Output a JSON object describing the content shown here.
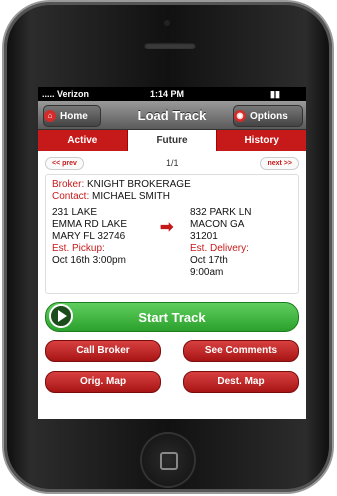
{
  "status": {
    "carrier": "..... Verizon",
    "time": "1:14 PM"
  },
  "navbar": {
    "title": "Load Track",
    "home_label": "Home",
    "options_label": "Options"
  },
  "tabs": [
    {
      "label": "Active"
    },
    {
      "label": "Future"
    },
    {
      "label": "History"
    }
  ],
  "pager": {
    "prev": "<< prev",
    "page": "1/1",
    "next": "next >>"
  },
  "load": {
    "broker_label": "Broker:",
    "broker": "KNIGHT BROKERAGE",
    "contact_label": "Contact:",
    "contact": "MICHAEL SMITH",
    "origin": [
      "231 LAKE",
      "EMMA RD LAKE",
      "MARY FL 32746"
    ],
    "dest": [
      "832 PARK LN",
      "MACON GA",
      "31201"
    ],
    "pickup_label": "Est. Pickup:",
    "pickup": "Oct 16th 3:00pm",
    "delivery_label": "Est. Delivery:",
    "delivery": [
      "Oct 17th",
      "9:00am"
    ]
  },
  "actions": {
    "start": "Start Track",
    "call_broker": "Call Broker",
    "see_comments": "See Comments",
    "orig_map": "Orig. Map",
    "dest_map": "Dest. Map"
  },
  "colors": {
    "accent": "#c61a1a",
    "start": "#2ba02b"
  }
}
